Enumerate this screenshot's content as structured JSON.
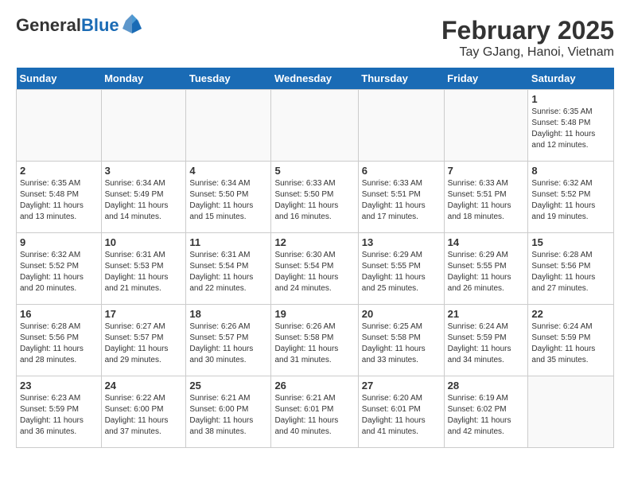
{
  "header": {
    "logo_line1": "General",
    "logo_line2": "Blue",
    "month_title": "February 2025",
    "location": "Tay GJang, Hanoi, Vietnam"
  },
  "weekdays": [
    "Sunday",
    "Monday",
    "Tuesday",
    "Wednesday",
    "Thursday",
    "Friday",
    "Saturday"
  ],
  "weeks": [
    [
      {
        "day": "",
        "info": ""
      },
      {
        "day": "",
        "info": ""
      },
      {
        "day": "",
        "info": ""
      },
      {
        "day": "",
        "info": ""
      },
      {
        "day": "",
        "info": ""
      },
      {
        "day": "",
        "info": ""
      },
      {
        "day": "1",
        "info": "Sunrise: 6:35 AM\nSunset: 5:48 PM\nDaylight: 11 hours\nand 12 minutes."
      }
    ],
    [
      {
        "day": "2",
        "info": "Sunrise: 6:35 AM\nSunset: 5:48 PM\nDaylight: 11 hours\nand 13 minutes."
      },
      {
        "day": "3",
        "info": "Sunrise: 6:34 AM\nSunset: 5:49 PM\nDaylight: 11 hours\nand 14 minutes."
      },
      {
        "day": "4",
        "info": "Sunrise: 6:34 AM\nSunset: 5:50 PM\nDaylight: 11 hours\nand 15 minutes."
      },
      {
        "day": "5",
        "info": "Sunrise: 6:33 AM\nSunset: 5:50 PM\nDaylight: 11 hours\nand 16 minutes."
      },
      {
        "day": "6",
        "info": "Sunrise: 6:33 AM\nSunset: 5:51 PM\nDaylight: 11 hours\nand 17 minutes."
      },
      {
        "day": "7",
        "info": "Sunrise: 6:33 AM\nSunset: 5:51 PM\nDaylight: 11 hours\nand 18 minutes."
      },
      {
        "day": "8",
        "info": "Sunrise: 6:32 AM\nSunset: 5:52 PM\nDaylight: 11 hours\nand 19 minutes."
      }
    ],
    [
      {
        "day": "9",
        "info": "Sunrise: 6:32 AM\nSunset: 5:52 PM\nDaylight: 11 hours\nand 20 minutes."
      },
      {
        "day": "10",
        "info": "Sunrise: 6:31 AM\nSunset: 5:53 PM\nDaylight: 11 hours\nand 21 minutes."
      },
      {
        "day": "11",
        "info": "Sunrise: 6:31 AM\nSunset: 5:54 PM\nDaylight: 11 hours\nand 22 minutes."
      },
      {
        "day": "12",
        "info": "Sunrise: 6:30 AM\nSunset: 5:54 PM\nDaylight: 11 hours\nand 24 minutes."
      },
      {
        "day": "13",
        "info": "Sunrise: 6:29 AM\nSunset: 5:55 PM\nDaylight: 11 hours\nand 25 minutes."
      },
      {
        "day": "14",
        "info": "Sunrise: 6:29 AM\nSunset: 5:55 PM\nDaylight: 11 hours\nand 26 minutes."
      },
      {
        "day": "15",
        "info": "Sunrise: 6:28 AM\nSunset: 5:56 PM\nDaylight: 11 hours\nand 27 minutes."
      }
    ],
    [
      {
        "day": "16",
        "info": "Sunrise: 6:28 AM\nSunset: 5:56 PM\nDaylight: 11 hours\nand 28 minutes."
      },
      {
        "day": "17",
        "info": "Sunrise: 6:27 AM\nSunset: 5:57 PM\nDaylight: 11 hours\nand 29 minutes."
      },
      {
        "day": "18",
        "info": "Sunrise: 6:26 AM\nSunset: 5:57 PM\nDaylight: 11 hours\nand 30 minutes."
      },
      {
        "day": "19",
        "info": "Sunrise: 6:26 AM\nSunset: 5:58 PM\nDaylight: 11 hours\nand 31 minutes."
      },
      {
        "day": "20",
        "info": "Sunrise: 6:25 AM\nSunset: 5:58 PM\nDaylight: 11 hours\nand 33 minutes."
      },
      {
        "day": "21",
        "info": "Sunrise: 6:24 AM\nSunset: 5:59 PM\nDaylight: 11 hours\nand 34 minutes."
      },
      {
        "day": "22",
        "info": "Sunrise: 6:24 AM\nSunset: 5:59 PM\nDaylight: 11 hours\nand 35 minutes."
      }
    ],
    [
      {
        "day": "23",
        "info": "Sunrise: 6:23 AM\nSunset: 5:59 PM\nDaylight: 11 hours\nand 36 minutes."
      },
      {
        "day": "24",
        "info": "Sunrise: 6:22 AM\nSunset: 6:00 PM\nDaylight: 11 hours\nand 37 minutes."
      },
      {
        "day": "25",
        "info": "Sunrise: 6:21 AM\nSunset: 6:00 PM\nDaylight: 11 hours\nand 38 minutes."
      },
      {
        "day": "26",
        "info": "Sunrise: 6:21 AM\nSunset: 6:01 PM\nDaylight: 11 hours\nand 40 minutes."
      },
      {
        "day": "27",
        "info": "Sunrise: 6:20 AM\nSunset: 6:01 PM\nDaylight: 11 hours\nand 41 minutes."
      },
      {
        "day": "28",
        "info": "Sunrise: 6:19 AM\nSunset: 6:02 PM\nDaylight: 11 hours\nand 42 minutes."
      },
      {
        "day": "",
        "info": ""
      }
    ]
  ]
}
